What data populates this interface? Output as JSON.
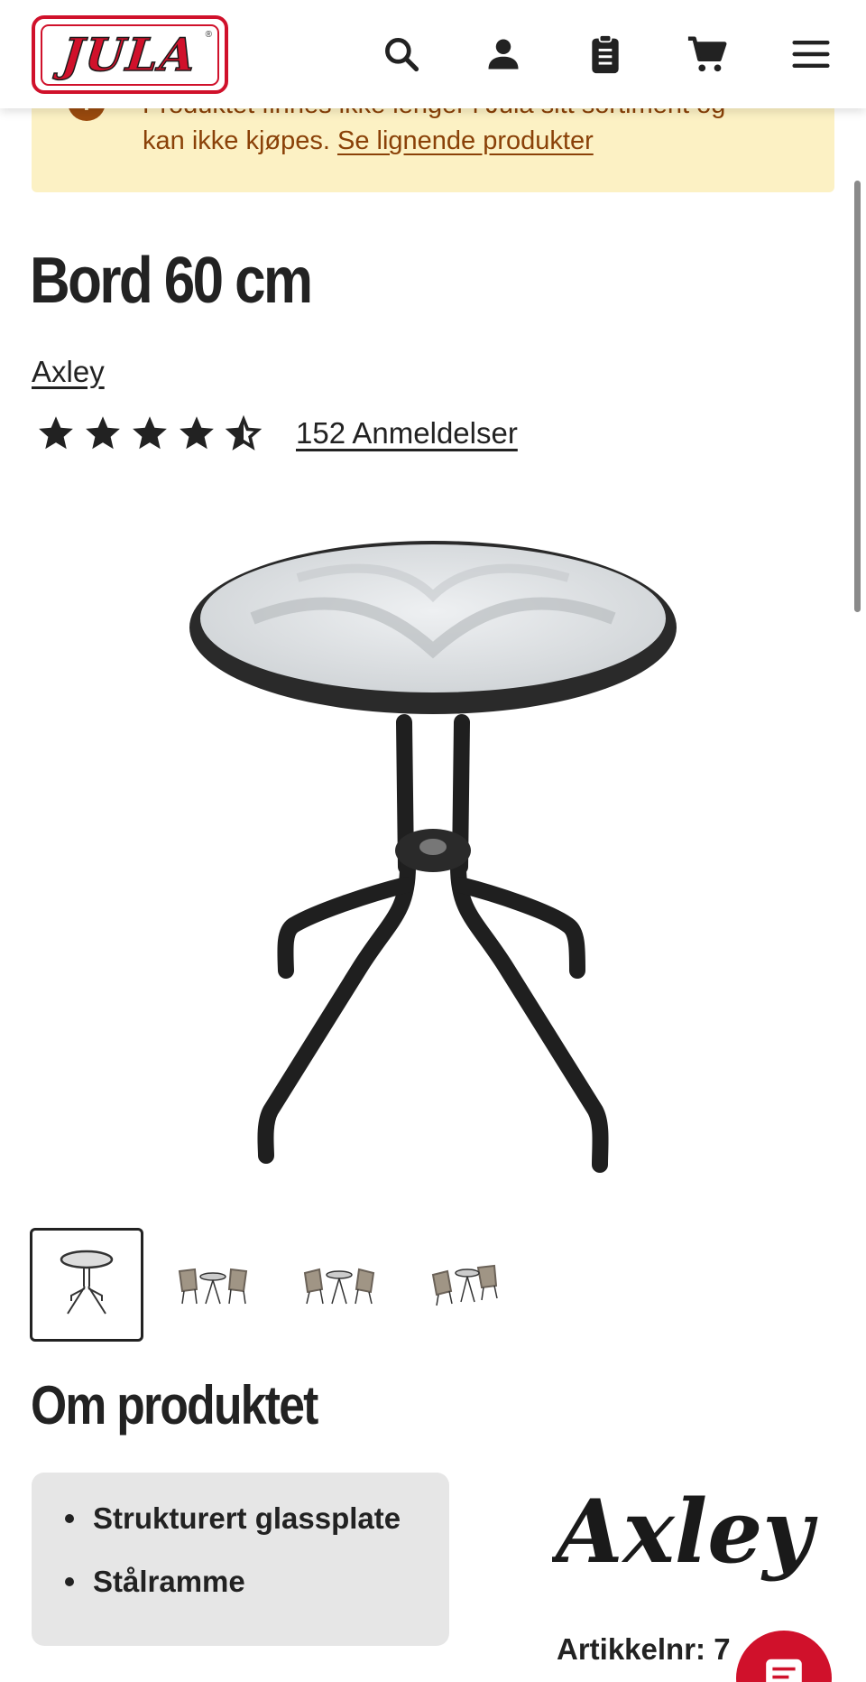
{
  "header": {
    "logo_text": "JULA",
    "logo_mark": "®",
    "icons": [
      "search-icon",
      "account-icon",
      "clipboard-icon",
      "cart-icon",
      "menu-icon"
    ],
    "brand_color": "#d0112b"
  },
  "notice": {
    "line1": "Produktet finnes ikke lenger i Jula sitt sortiment og",
    "line2_text": "kan ikke kjøpes. ",
    "link": "Se lignende produkter",
    "background": "#fcf1c4",
    "text_color": "#8a4108"
  },
  "product": {
    "title": "Bord 60 cm",
    "brand": "Axley",
    "rating_stars": 4.5,
    "rating_max": 5,
    "reviews": "152 Anmeldelser"
  },
  "gallery": {
    "thumbnails": [
      "table",
      "table-with-chairs",
      "table-with-chairs",
      "table-with-chairs"
    ],
    "active_index": 0
  },
  "about": {
    "heading": "Om produktet",
    "features": [
      "Strukturert glassplate",
      "Stålramme"
    ],
    "brand_logo": "Axley",
    "article_number": "Artikkelnr: 7"
  },
  "chat": {
    "icon": "chat-icon"
  }
}
